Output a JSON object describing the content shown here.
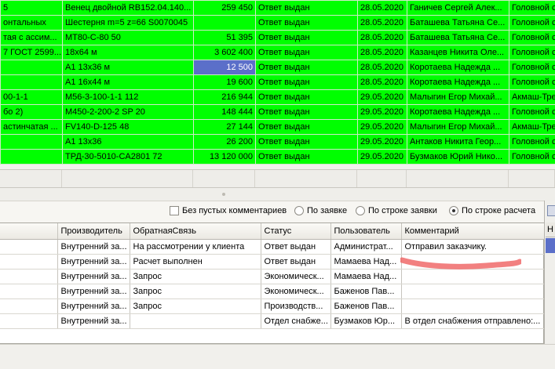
{
  "top_rows": [
    [
      "5",
      "Венец двойной RB152.04.140...",
      "259 450",
      "Ответ выдан",
      "28.05.2020",
      "Ганичев Сергей Алек...",
      "Головной с"
    ],
    [
      "онтальных",
      "Шестерня m=5 z=66 S0070045",
      "",
      "Ответ выдан",
      "28.05.2020",
      "Баташева Татьяна Се...",
      "Головной с"
    ],
    [
      "тая с ассим...",
      "MT80-C-80 50",
      "51 395",
      "Ответ выдан",
      "28.05.2020",
      "Баташева Татьяна Се...",
      "Головной с"
    ],
    [
      "7 ГОСТ 2599...",
      "18х64 м",
      "3 602 400",
      "Ответ выдан",
      "28.05.2020",
      "Казанцев Никита Оле...",
      "Головной с"
    ],
    [
      "",
      "А1 13х36 м",
      "12 500",
      "Ответ выдан",
      "28.05.2020",
      "Коротаева Надежда ...",
      "Головной с"
    ],
    [
      "",
      "А1 16х44 м",
      "19 600",
      "Ответ выдан",
      "28.05.2020",
      "Коротаева Надежда ...",
      "Головной с"
    ],
    [
      "00-1-1",
      "M56-3-100-1-1 112",
      "216 944",
      "Ответ выдан",
      "29.05.2020",
      "Малыгин Егор Михай...",
      "Акмаш-Тре"
    ],
    [
      "бо 2)",
      "M450-2-200-2 SP 20",
      "148 444",
      "Ответ выдан",
      "29.05.2020",
      "Коротаева Надежда ...",
      "Головной с"
    ],
    [
      "астинчатая ...",
      "FV140-D-125 48",
      "27 144",
      "Ответ выдан",
      "29.05.2020",
      "Малыгин Егор Михай...",
      "Акмаш-Тре"
    ],
    [
      "",
      "А1 13х36",
      "26 200",
      "Ответ выдан",
      "29.05.2020",
      "Антаков Никита Геор...",
      "Головной с"
    ],
    [
      "",
      "ТРД-30-5010-CA2801 72",
      "13 120 000",
      "Ответ выдан",
      "29.05.2020",
      "Бузмаков Юрий Нико...",
      "Головной с"
    ]
  ],
  "options": {
    "no_empty_comments": "Без пустых комментариев",
    "by_request": "По заявке",
    "by_request_line": "По строке заявки",
    "by_calc_line": "По строке расчета",
    "selected": "by_calc_line"
  },
  "grid": {
    "headers": [
      "",
      "Производитель",
      "ОбратнаяСвязь",
      "Статус",
      "Пользователь",
      "Комментарий"
    ],
    "rows": [
      [
        "",
        "Внутренний за...",
        "На рассмотрении у клиента",
        "Ответ выдан",
        "Администрат...",
        "Отправил заказчику."
      ],
      [
        "",
        "Внутренний за...",
        "Расчет выполнен",
        "Ответ выдан",
        "Мамаева Над...",
        ""
      ],
      [
        "",
        "Внутренний за...",
        "Запрос",
        "Экономическ...",
        "Мамаева Над...",
        ""
      ],
      [
        "",
        "Внутренний за...",
        "Запрос",
        "Экономическ...",
        "Баженов Пав...",
        ""
      ],
      [
        "",
        "Внутренний за...",
        "Запрос",
        "Производств...",
        "Баженов Пав...",
        ""
      ],
      [
        "",
        "Внутренний за...",
        "",
        "Отдел снабже...",
        "Бузмаков Юр...",
        "В отдел снабжения отправлено:..."
      ]
    ]
  },
  "right_panel_header": "Н",
  "colors": {
    "row_green": "#00ff00",
    "selection": "#5b6fc9",
    "scribble": "#f06a6a"
  }
}
